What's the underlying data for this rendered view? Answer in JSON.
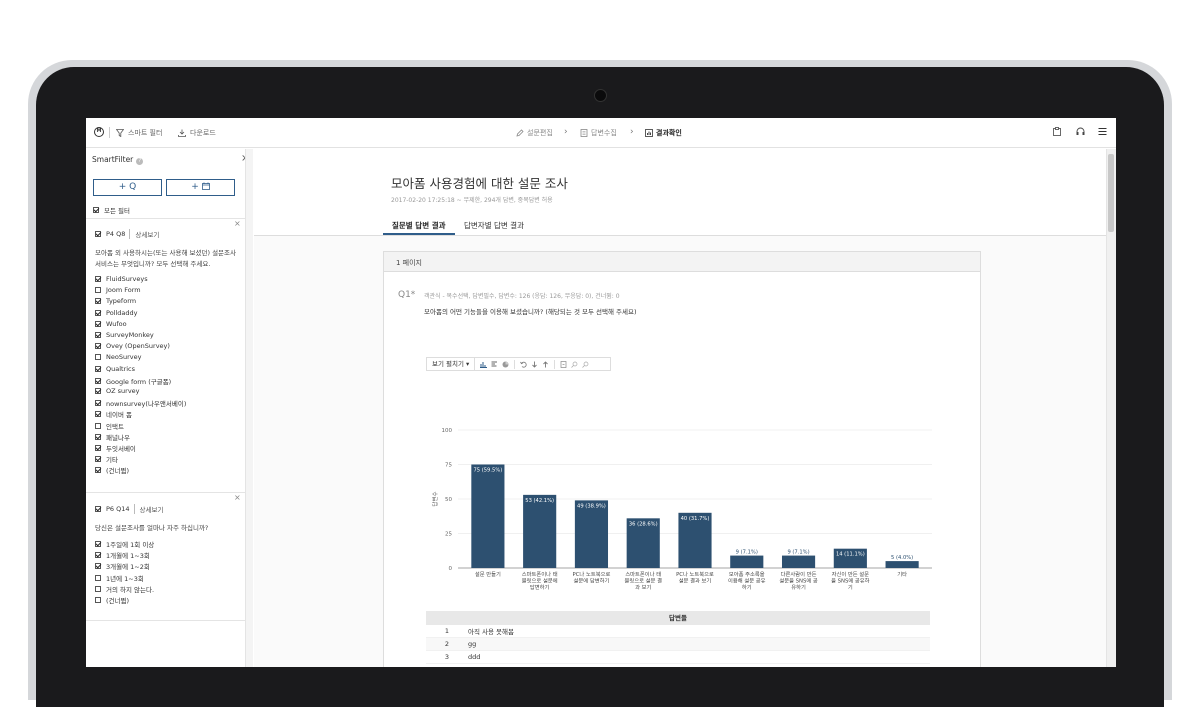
{
  "topbar": {
    "smart_filter": "스마트 필터",
    "download": "다운로드",
    "crumbs": [
      "설문편집",
      "답변수집",
      "결과확인"
    ]
  },
  "sidebar": {
    "title": "SmartFilter",
    "add_question_btn": "+ Q",
    "add_date_btn": "+",
    "all_filters": "모든 필터",
    "filter1": {
      "qid": "P4 Q8",
      "detail": "상세보기",
      "question": "모아폼 외 사용하시는(또는 사용해 보셨던) 설문조사 서비스는 무엇입니까? 모두 선택해 주세요.",
      "options": [
        {
          "label": "FluidSurveys",
          "checked": true
        },
        {
          "label": "Joom Form",
          "checked": false
        },
        {
          "label": "Typeform",
          "checked": true
        },
        {
          "label": "Polldaddy",
          "checked": true
        },
        {
          "label": "Wufoo",
          "checked": true
        },
        {
          "label": "SurveyMonkey",
          "checked": true
        },
        {
          "label": "Ovey (OpenSurvey)",
          "checked": true
        },
        {
          "label": "NeoSurvey",
          "checked": false
        },
        {
          "label": "Qualtrics",
          "checked": true
        },
        {
          "label": "Google form (구글폼)",
          "checked": true
        },
        {
          "label": "OZ survey",
          "checked": true
        },
        {
          "label": "nownsurvey(나우앤서베이)",
          "checked": true
        },
        {
          "label": "네이버 폼",
          "checked": true
        },
        {
          "label": "인택트",
          "checked": false
        },
        {
          "label": "패널나우",
          "checked": true
        },
        {
          "label": "두잇서베이",
          "checked": true
        },
        {
          "label": "기타",
          "checked": true
        },
        {
          "label": "(건너뜀)",
          "checked": true
        }
      ]
    },
    "filter2": {
      "qid": "P6 Q14",
      "detail": "상세보기",
      "question": "당신은 설문조사를 얼마나 자주 하십니까?",
      "options": [
        {
          "label": "1주일에 1회 이상",
          "checked": true
        },
        {
          "label": "1개월에 1~3회",
          "checked": true
        },
        {
          "label": "3개월에 1~2회",
          "checked": true
        },
        {
          "label": "1년에 1~3회",
          "checked": false
        },
        {
          "label": "거의 하지 않는다.",
          "checked": false
        },
        {
          "label": "(건너뜀)",
          "checked": false
        }
      ]
    }
  },
  "main": {
    "title": "모아폼 사용경험에 대한 설문 조사",
    "meta": "2017-02-20 17:25:18 ~ 무제한, 294개 답변, 중복답변 허용",
    "tabs": [
      "질문별 답변 결과",
      "답변자별 답변 결과"
    ],
    "page_label": "1 페이지",
    "question_number": "Q1*",
    "question_meta": "객관식 - 복수선택, 답변필수, 답변수: 126 (응답: 126, 무응답: 0), 건너뜀: 0",
    "question_text": "모아폼의 어떤 기능들을 이용해 보셨습니까? (해당되는 것 모두 선택해 주세요)",
    "view_toggle": "보기 펼치기",
    "answers_header": "답변들",
    "answers": [
      {
        "n": "1",
        "text": "아직 사용 못해봄"
      },
      {
        "n": "2",
        "text": "gg"
      },
      {
        "n": "3",
        "text": "ddd"
      }
    ]
  },
  "chart_data": {
    "type": "bar",
    "ylabel": "답변수",
    "ylim": [
      0,
      100
    ],
    "yticks": [
      0,
      25,
      50,
      75,
      100
    ],
    "categories": [
      [
        "설문 만들기"
      ],
      [
        "스마트폰이나 태",
        "블릿으로 설문에",
        "답변하기"
      ],
      [
        "PC나 노트북으로",
        "설문에 답변하기"
      ],
      [
        "스마트폰이나 태",
        "블릿으로 설문 결",
        "과 보기"
      ],
      [
        "PC나 노트북으로",
        "설문 결과 보기"
      ],
      [
        "모아폼 주소록을",
        "이용해 설문 공유",
        "하기"
      ],
      [
        "다른사람이 만든",
        "설문을 SNS에 공",
        "유하기"
      ],
      [
        "자신이 만든 설문",
        "을 SNS에 공유하",
        "기"
      ],
      [
        "기타"
      ]
    ],
    "values": [
      75,
      53,
      49,
      36,
      40,
      9,
      9,
      14,
      5
    ],
    "labels": [
      "75 (59.5%)",
      "53 (42.1%)",
      "49 (38.9%)",
      "36 (28.6%)",
      "40 (31.7%)",
      "9 (7.1%)",
      "9 (7.1%)",
      "14 (11.1%)",
      "5 (4.0%)"
    ],
    "bar_color": "#2d5070"
  }
}
